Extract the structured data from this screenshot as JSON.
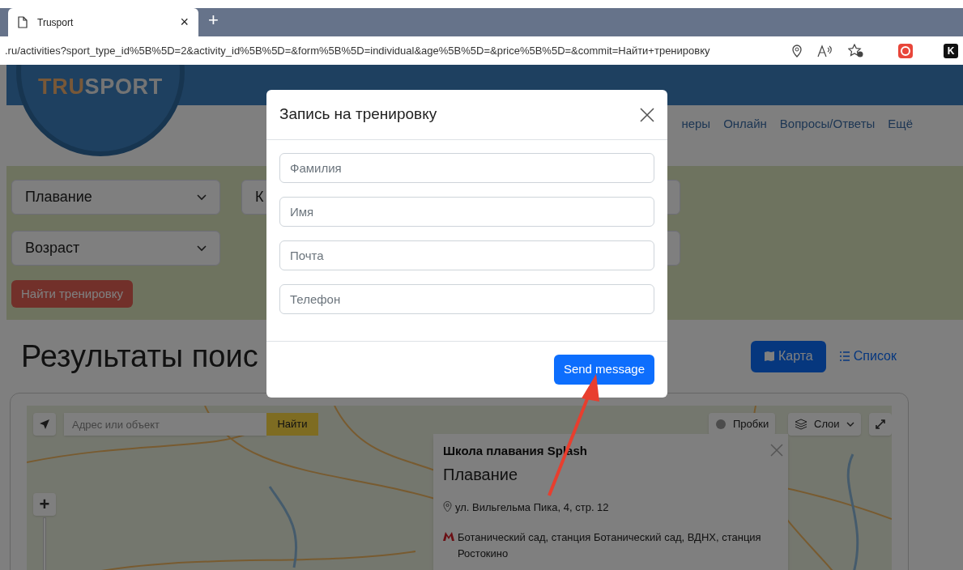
{
  "browser": {
    "tab": {
      "title": "Trusport",
      "close": "×"
    },
    "new_tab": "+",
    "url": ".ru/activities?sport_type_id%5B%5D=2&activity_id%5B%5D=&form%5B%5D=individual&age%5B%5D=&price%5B%5D=&commit=Найти+тренировку",
    "extension_label": "K"
  },
  "header": {
    "logo": {
      "part_1": "TRU",
      "part_2": "SPORT"
    },
    "nav": [
      "неры",
      "Онлайн",
      "Вопросы/Ответы",
      "Ещё"
    ]
  },
  "filters": {
    "selects": [
      {
        "value": "Плавание"
      },
      {
        "value": "К"
      },
      {
        "value": "Возраст"
      }
    ],
    "search_button": "Найти тренировку"
  },
  "results": {
    "heading": "Результаты поис",
    "views": [
      {
        "label": "Карта",
        "selected": true
      },
      {
        "label": "Список",
        "selected": false
      }
    ]
  },
  "map": {
    "search": {
      "placeholder": "Адрес или объект",
      "button": "Найти"
    },
    "traffic": "Пробки",
    "layers": "Слои",
    "zoom_in": "+",
    "balloon": {
      "title": "Школа плавания Splash",
      "subtitle": "Плавание",
      "address": "ул. Вильгельма Пика, 4, стр. 12",
      "metro": "Ботанический сад, станция Ботанический сад, ВДНХ, станция Ростокино"
    }
  },
  "modal": {
    "title": "Запись на тренировку",
    "fields": [
      {
        "placeholder": "Фамилия"
      },
      {
        "placeholder": "Имя"
      },
      {
        "placeholder": "Почта"
      },
      {
        "placeholder": "Телефон"
      }
    ],
    "submit": "Send message"
  }
}
